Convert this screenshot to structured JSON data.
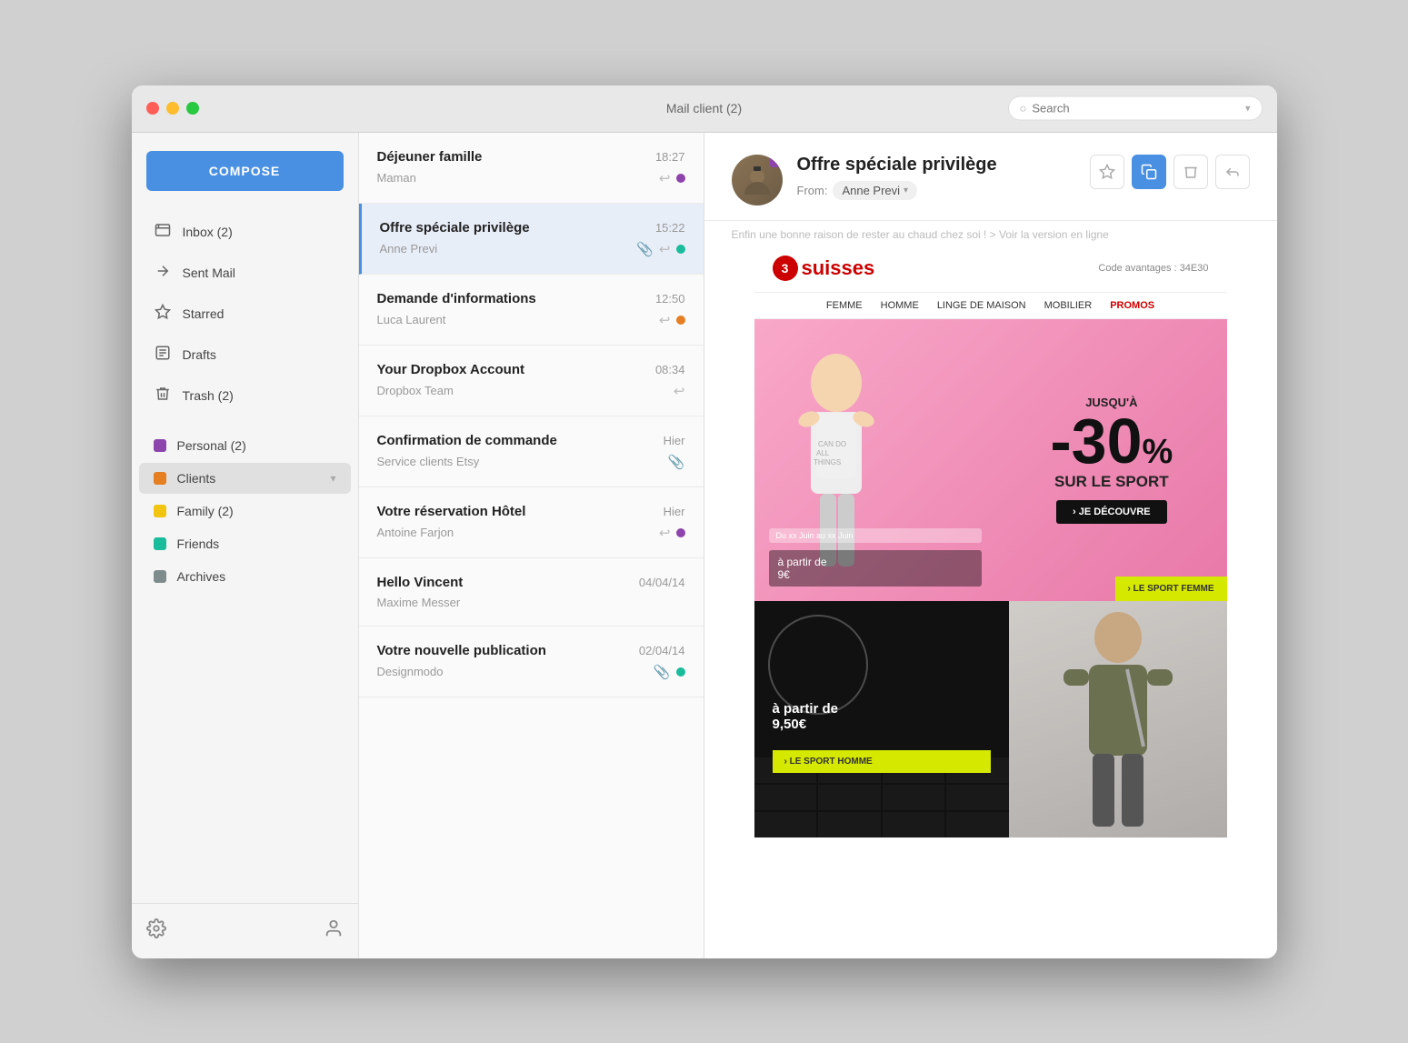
{
  "window": {
    "title": "Mail client (2)",
    "search_placeholder": "Search"
  },
  "compose_button": "COMPOSE",
  "sidebar": {
    "nav_items": [
      {
        "id": "inbox",
        "label": "Inbox (2)",
        "icon": "📥"
      },
      {
        "id": "sent",
        "label": "Sent Mail",
        "icon": "📤"
      },
      {
        "id": "starred",
        "label": "Starred",
        "icon": "☆"
      },
      {
        "id": "drafts",
        "label": "Drafts",
        "icon": "📋"
      },
      {
        "id": "trash",
        "label": "Trash (2)",
        "icon": "🗑"
      }
    ],
    "labels": [
      {
        "id": "personal",
        "label": "Personal (2)",
        "color": "#8e44ad"
      },
      {
        "id": "clients",
        "label": "Clients",
        "color": "#e67e22"
      },
      {
        "id": "family",
        "label": "Family (2)",
        "color": "#f1c40f"
      },
      {
        "id": "friends",
        "label": "Friends",
        "color": "#1abc9c"
      },
      {
        "id": "archives",
        "label": "Archives",
        "color": "#7f8c8d"
      }
    ],
    "footer": {
      "settings_label": "Settings",
      "profile_label": "Profile"
    }
  },
  "email_list": {
    "emails": [
      {
        "id": 1,
        "sender": "Déjeuner famille",
        "from": "Maman",
        "time": "18:27",
        "has_reply": true,
        "dot_color": "#8e44ad",
        "selected": false
      },
      {
        "id": 2,
        "sender": "Offre spéciale privilège",
        "from": "Anne Previ",
        "time": "15:22",
        "has_attachment": true,
        "has_reply": true,
        "dot_color": "#1abc9c",
        "selected": true
      },
      {
        "id": 3,
        "sender": "Demande d'informations",
        "from": "Luca Laurent",
        "time": "12:50",
        "has_reply": true,
        "dot_color": "#e67e22",
        "selected": false
      },
      {
        "id": 4,
        "sender": "Your Dropbox Account",
        "from": "Dropbox Team",
        "time": "08:34",
        "has_reply": true,
        "selected": false
      },
      {
        "id": 5,
        "sender": "Confirmation de commande",
        "from": "Service clients Etsy",
        "time": "Hier",
        "has_attachment": true,
        "selected": false
      },
      {
        "id": 6,
        "sender": "Votre réservation Hôtel",
        "from": "Antoine Farjon",
        "time": "Hier",
        "has_reply": true,
        "dot_color": "#8e44ad",
        "selected": false
      },
      {
        "id": 7,
        "sender": "Hello Vincent",
        "from": "Maxime Messer",
        "time": "04/04/14",
        "selected": false
      },
      {
        "id": 8,
        "sender": "Votre nouvelle publication",
        "from": "Designmodo",
        "time": "02/04/14",
        "has_attachment": true,
        "dot_color": "#1abc9c",
        "selected": false
      }
    ]
  },
  "email_detail": {
    "subject": "Offre spéciale privilège",
    "from_label": "From:",
    "from_name": "Anne Previ",
    "preview_text": "Enfin une bonne raison de rester au chaud chez soi ! > Voir la version en ligne",
    "promo": {
      "logo_text": "suisses",
      "logo_number": "3",
      "code_label": "Code avantages : 34E30",
      "nav_items": [
        "FEMME",
        "HOMME",
        "LINGE DE MAISON",
        "MOBILIER",
        "PROMOS"
      ],
      "banner_date": "Du xx Juin au xx Juin",
      "jusqu_a": "JUSQU'À",
      "discount": "-30",
      "percent": "%",
      "sur_le": "SUR LE SPORT",
      "je_decouvre": "› JE DÉCOUVRE",
      "banner_price": "à partir de\n9€",
      "le_sport_femme": "› LE SPORT FEMME",
      "prix_a_partir": "à partir de\n9,50€",
      "le_sport_homme": "› LE SPORT HOMME"
    },
    "actions": {
      "star": "☆",
      "copy": "⧉",
      "delete": "🗑",
      "reply": "↩"
    }
  }
}
